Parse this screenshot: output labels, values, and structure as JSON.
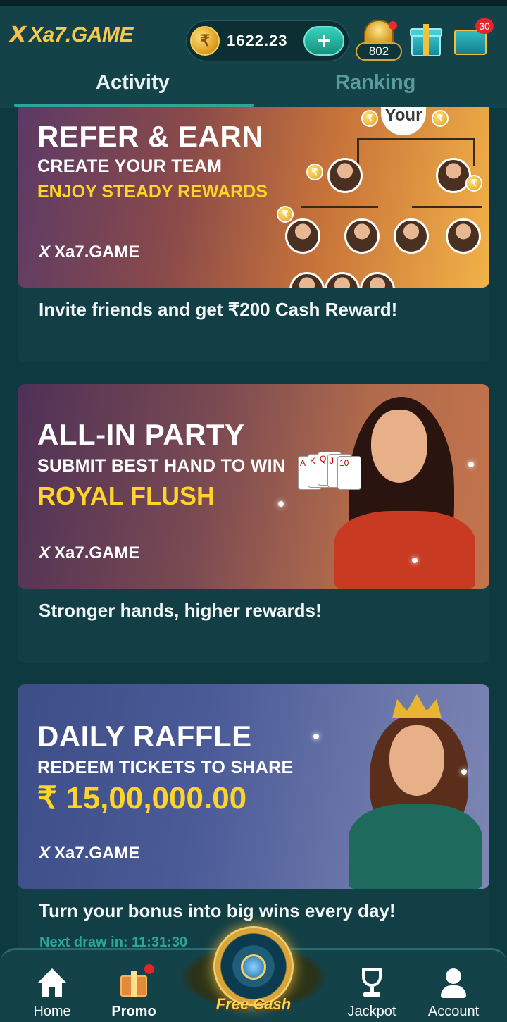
{
  "header": {
    "logo_mark": "X",
    "logo_text": "Xa7.GAME",
    "currency_symbol": "₹",
    "balance": "1622.23",
    "add_funds_label": "+",
    "vip_points": "802",
    "mail_count": "30"
  },
  "tabs": [
    {
      "label": "Activity",
      "active": true
    },
    {
      "label": "Ranking",
      "active": false
    }
  ],
  "cards": [
    {
      "title": "REFER & EARN",
      "subtitle": "CREATE YOUR TEAM",
      "highlight": "ENJOY STEADY REWARDS",
      "brand": "Xa7.GAME",
      "tree_root_label": "Your",
      "description": "Invite friends and get ₹200 Cash Reward!"
    },
    {
      "title": "ALL-IN PARTY",
      "subtitle": "SUBMIT BEST HAND TO WIN",
      "highlight": "ROYAL FLUSH",
      "brand": "Xa7.GAME",
      "description": "Stronger hands, higher rewards!"
    },
    {
      "title": "DAILY RAFFLE",
      "subtitle": "REDEEM TICKETS TO SHARE",
      "highlight": "₹ 15,00,000.00",
      "brand": "Xa7.GAME",
      "description": "Turn your bonus into big wins every day!",
      "next_draw": "Next draw in: 11:31:30"
    }
  ],
  "bottom_nav": {
    "items": [
      {
        "label": "Home",
        "icon": "home-icon"
      },
      {
        "label": "Promo",
        "icon": "gift-icon",
        "active": true
      },
      {
        "label": "Free Cash",
        "icon": "spin-wheel-icon"
      },
      {
        "label": "Jackpot",
        "icon": "trophy-icon"
      },
      {
        "label": "Account",
        "icon": "user-icon"
      }
    ]
  },
  "colors": {
    "background": "#0e3a3f",
    "header": "#134248",
    "accent_teal": "#2ba69a",
    "gold": "#ffd428"
  }
}
